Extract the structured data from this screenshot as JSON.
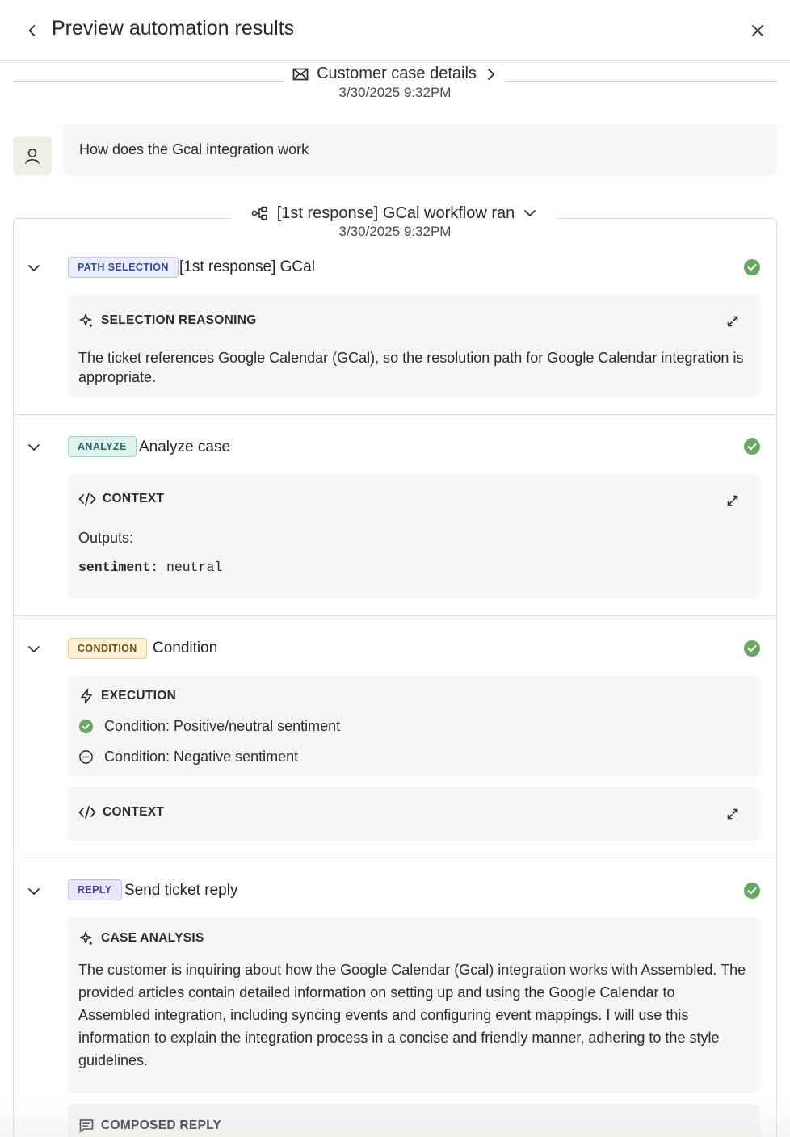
{
  "header": {
    "title": "Preview automation results"
  },
  "case": {
    "label": "Customer case details",
    "timestamp": "3/30/2025 9:32PM"
  },
  "message": {
    "text": "How does the Gcal integration work"
  },
  "workflow": {
    "label": "[1st response] GCal workflow ran",
    "timestamp": "3/30/2025 9:32PM"
  },
  "steps": [
    {
      "badge": "PATH SELECTION",
      "title": "[1st response] GCal",
      "panel_heading": "SELECTION REASONING",
      "panel_text": "The ticket references Google Calendar (GCal), so the resolution path for Google Calendar integration is appropriate."
    },
    {
      "badge": "ANALYZE",
      "title": "Analyze case",
      "panel_heading": "CONTEXT",
      "outputs_label": "Outputs:",
      "output_key": "sentiment:",
      "output_value": "neutral"
    },
    {
      "badge": "CONDITION",
      "title": "Condition",
      "panel_heading": "EXECUTION",
      "conditions": [
        {
          "label": "Condition: Positive/neutral sentiment",
          "state": "passed"
        },
        {
          "label": "Condition: Negative sentiment",
          "state": "skipped"
        }
      ],
      "context_heading": "CONTEXT"
    },
    {
      "badge": "REPLY",
      "title": "Send ticket reply",
      "panel_heading": "CASE ANALYSIS",
      "panel_text": "The customer is inquiring about how the Google Calendar (Gcal) integration works with Assembled. The provided articles contain detailed information on setting up and using the Google Calendar to Assembled integration, including syncing events and configuring event mappings. I will use this information to explain the integration process in a concise and friendly manner, adhering to the style guidelines.",
      "composed_heading": "COMPOSED REPLY"
    }
  ],
  "icons": {
    "back": "chevron-left-icon",
    "close": "close-icon",
    "mail": "mail-icon",
    "workflow": "workflow-icon",
    "user": "user-icon",
    "sparkle": "sparkle-icon",
    "code": "code-icon",
    "bolt": "bolt-icon",
    "message": "message-icon",
    "check": "check-circle-icon",
    "skipped": "minus-circle-icon",
    "expand": "expand-icon"
  },
  "colors": {
    "success": "#6aa765",
    "path_badge_bg": "#e8ecfb",
    "path_badge_border": "#b9c3ee",
    "path_badge_text": "#3a4a8c",
    "analyze_badge_bg": "#def3ee",
    "analyze_badge_border": "#9fd5c8",
    "analyze_badge_text": "#2c6a5b",
    "condition_badge_bg": "#fdf1d6",
    "condition_badge_border": "#eccb82",
    "condition_badge_text": "#6d5216",
    "reply_badge_bg": "#ebe7fa",
    "reply_badge_border": "#c3b8ec",
    "reply_badge_text": "#4b3d8a"
  }
}
